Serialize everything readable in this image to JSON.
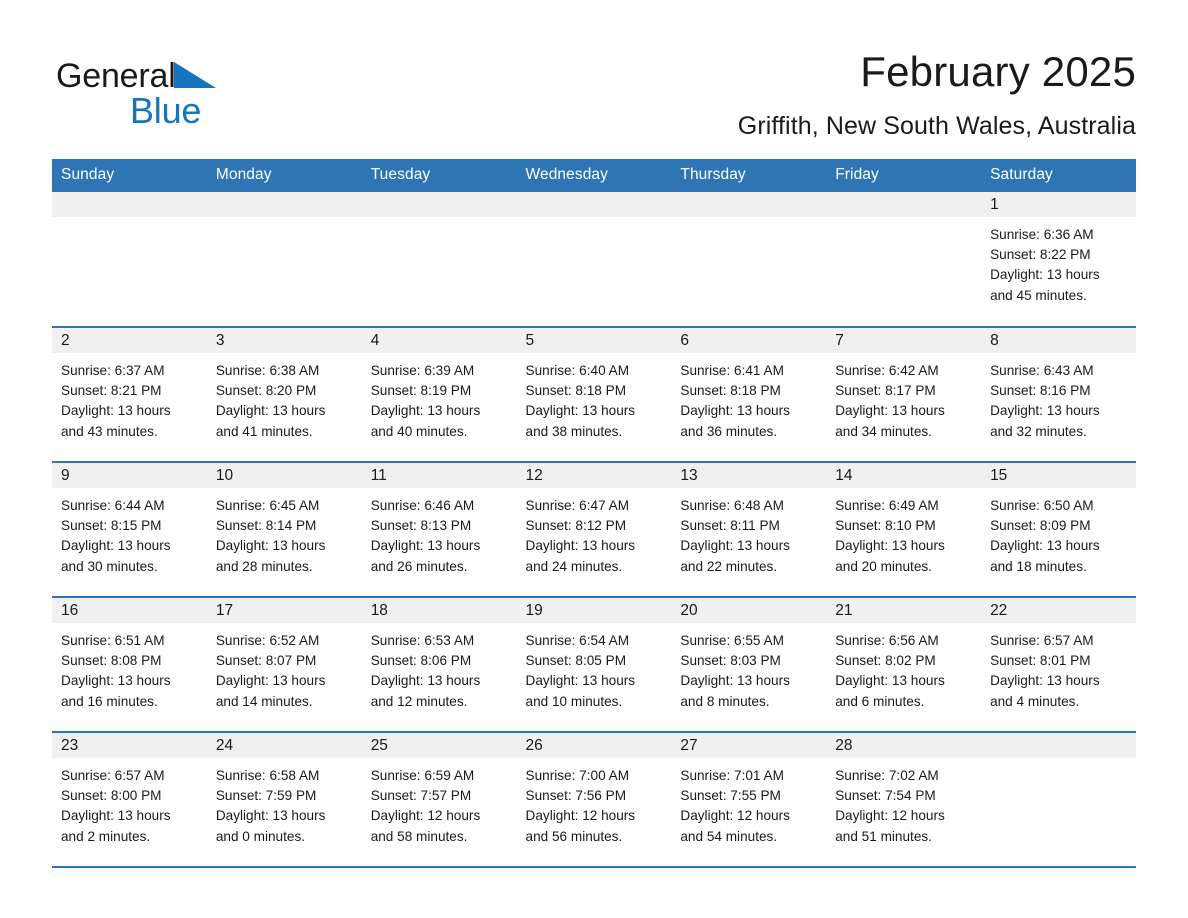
{
  "logo": {
    "word1": "General",
    "word2": "Blue",
    "triangle_color": "#1675bc",
    "text_color": "#1a1a1a"
  },
  "header": {
    "title": "February 2025",
    "subtitle": "Griffith, New South Wales, Australia"
  },
  "theme": {
    "header_blue": "#2e75b6",
    "row_divider_blue": "#2e75b6",
    "daynum_band": "#f0f0f0",
    "text": "#1a1a1a",
    "header_text": "#ffffff"
  },
  "calendar": {
    "weekday_headers": [
      "Sunday",
      "Monday",
      "Tuesday",
      "Wednesday",
      "Thursday",
      "Friday",
      "Saturday"
    ],
    "weeks": [
      [
        {
          "day": "",
          "lines": []
        },
        {
          "day": "",
          "lines": []
        },
        {
          "day": "",
          "lines": []
        },
        {
          "day": "",
          "lines": []
        },
        {
          "day": "",
          "lines": []
        },
        {
          "day": "",
          "lines": []
        },
        {
          "day": "1",
          "lines": [
            "Sunrise: 6:36 AM",
            "Sunset: 8:22 PM",
            "Daylight: 13 hours",
            "and 45 minutes."
          ]
        }
      ],
      [
        {
          "day": "2",
          "lines": [
            "Sunrise: 6:37 AM",
            "Sunset: 8:21 PM",
            "Daylight: 13 hours",
            "and 43 minutes."
          ]
        },
        {
          "day": "3",
          "lines": [
            "Sunrise: 6:38 AM",
            "Sunset: 8:20 PM",
            "Daylight: 13 hours",
            "and 41 minutes."
          ]
        },
        {
          "day": "4",
          "lines": [
            "Sunrise: 6:39 AM",
            "Sunset: 8:19 PM",
            "Daylight: 13 hours",
            "and 40 minutes."
          ]
        },
        {
          "day": "5",
          "lines": [
            "Sunrise: 6:40 AM",
            "Sunset: 8:18 PM",
            "Daylight: 13 hours",
            "and 38 minutes."
          ]
        },
        {
          "day": "6",
          "lines": [
            "Sunrise: 6:41 AM",
            "Sunset: 8:18 PM",
            "Daylight: 13 hours",
            "and 36 minutes."
          ]
        },
        {
          "day": "7",
          "lines": [
            "Sunrise: 6:42 AM",
            "Sunset: 8:17 PM",
            "Daylight: 13 hours",
            "and 34 minutes."
          ]
        },
        {
          "day": "8",
          "lines": [
            "Sunrise: 6:43 AM",
            "Sunset: 8:16 PM",
            "Daylight: 13 hours",
            "and 32 minutes."
          ]
        }
      ],
      [
        {
          "day": "9",
          "lines": [
            "Sunrise: 6:44 AM",
            "Sunset: 8:15 PM",
            "Daylight: 13 hours",
            "and 30 minutes."
          ]
        },
        {
          "day": "10",
          "lines": [
            "Sunrise: 6:45 AM",
            "Sunset: 8:14 PM",
            "Daylight: 13 hours",
            "and 28 minutes."
          ]
        },
        {
          "day": "11",
          "lines": [
            "Sunrise: 6:46 AM",
            "Sunset: 8:13 PM",
            "Daylight: 13 hours",
            "and 26 minutes."
          ]
        },
        {
          "day": "12",
          "lines": [
            "Sunrise: 6:47 AM",
            "Sunset: 8:12 PM",
            "Daylight: 13 hours",
            "and 24 minutes."
          ]
        },
        {
          "day": "13",
          "lines": [
            "Sunrise: 6:48 AM",
            "Sunset: 8:11 PM",
            "Daylight: 13 hours",
            "and 22 minutes."
          ]
        },
        {
          "day": "14",
          "lines": [
            "Sunrise: 6:49 AM",
            "Sunset: 8:10 PM",
            "Daylight: 13 hours",
            "and 20 minutes."
          ]
        },
        {
          "day": "15",
          "lines": [
            "Sunrise: 6:50 AM",
            "Sunset: 8:09 PM",
            "Daylight: 13 hours",
            "and 18 minutes."
          ]
        }
      ],
      [
        {
          "day": "16",
          "lines": [
            "Sunrise: 6:51 AM",
            "Sunset: 8:08 PM",
            "Daylight: 13 hours",
            "and 16 minutes."
          ]
        },
        {
          "day": "17",
          "lines": [
            "Sunrise: 6:52 AM",
            "Sunset: 8:07 PM",
            "Daylight: 13 hours",
            "and 14 minutes."
          ]
        },
        {
          "day": "18",
          "lines": [
            "Sunrise: 6:53 AM",
            "Sunset: 8:06 PM",
            "Daylight: 13 hours",
            "and 12 minutes."
          ]
        },
        {
          "day": "19",
          "lines": [
            "Sunrise: 6:54 AM",
            "Sunset: 8:05 PM",
            "Daylight: 13 hours",
            "and 10 minutes."
          ]
        },
        {
          "day": "20",
          "lines": [
            "Sunrise: 6:55 AM",
            "Sunset: 8:03 PM",
            "Daylight: 13 hours",
            "and 8 minutes."
          ]
        },
        {
          "day": "21",
          "lines": [
            "Sunrise: 6:56 AM",
            "Sunset: 8:02 PM",
            "Daylight: 13 hours",
            "and 6 minutes."
          ]
        },
        {
          "day": "22",
          "lines": [
            "Sunrise: 6:57 AM",
            "Sunset: 8:01 PM",
            "Daylight: 13 hours",
            "and 4 minutes."
          ]
        }
      ],
      [
        {
          "day": "23",
          "lines": [
            "Sunrise: 6:57 AM",
            "Sunset: 8:00 PM",
            "Daylight: 13 hours",
            "and 2 minutes."
          ]
        },
        {
          "day": "24",
          "lines": [
            "Sunrise: 6:58 AM",
            "Sunset: 7:59 PM",
            "Daylight: 13 hours",
            "and 0 minutes."
          ]
        },
        {
          "day": "25",
          "lines": [
            "Sunrise: 6:59 AM",
            "Sunset: 7:57 PM",
            "Daylight: 12 hours",
            "and 58 minutes."
          ]
        },
        {
          "day": "26",
          "lines": [
            "Sunrise: 7:00 AM",
            "Sunset: 7:56 PM",
            "Daylight: 12 hours",
            "and 56 minutes."
          ]
        },
        {
          "day": "27",
          "lines": [
            "Sunrise: 7:01 AM",
            "Sunset: 7:55 PM",
            "Daylight: 12 hours",
            "and 54 minutes."
          ]
        },
        {
          "day": "28",
          "lines": [
            "Sunrise: 7:02 AM",
            "Sunset: 7:54 PM",
            "Daylight: 12 hours",
            "and 51 minutes."
          ]
        },
        {
          "day": "",
          "lines": []
        }
      ]
    ]
  }
}
